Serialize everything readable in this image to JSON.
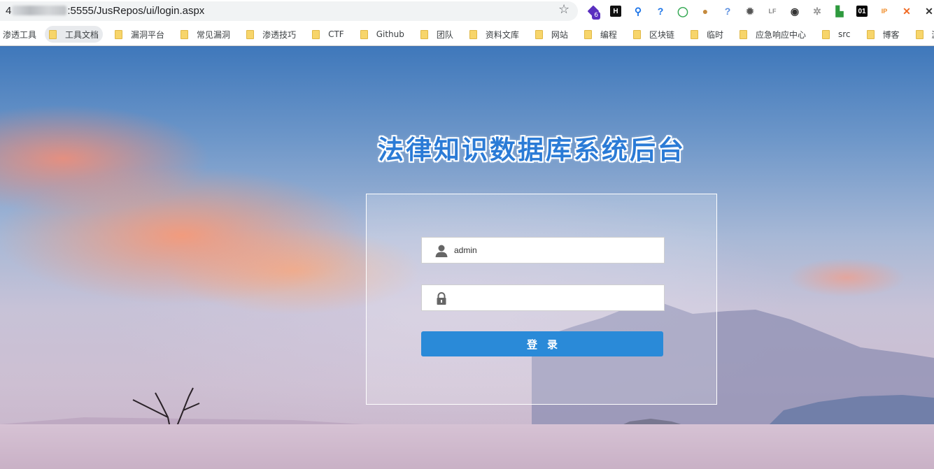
{
  "browser": {
    "url_prefix": "4",
    "url_visible": ":5555/JusRepos/ui/login.aspx",
    "bookmark_star_icon": "star-icon",
    "extensions": [
      {
        "name": "extension-diamond-icon",
        "label": "",
        "color": "#5a2fbf",
        "badge": "6"
      },
      {
        "name": "extension-h-icon",
        "label": "H",
        "color": "#111111"
      },
      {
        "name": "extension-pin-icon",
        "label": "⚲",
        "color": "#1a73e8"
      },
      {
        "name": "extension-question-icon",
        "label": "?",
        "color": "#1a73e8"
      },
      {
        "name": "extension-ring-icon",
        "label": "◯",
        "color": "#34a853"
      },
      {
        "name": "extension-cookie-icon",
        "label": "●",
        "color": "#c58a3d"
      },
      {
        "name": "extension-help-icon",
        "label": "?",
        "color": "#5b8fe0"
      },
      {
        "name": "extension-gear-icon",
        "label": "✹",
        "color": "#555555"
      },
      {
        "name": "extension-lf-icon",
        "label": "LF",
        "color": "#888888"
      },
      {
        "name": "extension-mask-icon",
        "label": "◉",
        "color": "#333333"
      },
      {
        "name": "extension-spoke-icon",
        "label": "✲",
        "color": "#999999"
      },
      {
        "name": "extension-leaf-icon",
        "label": "▙",
        "color": "#2e9a3e"
      },
      {
        "name": "extension-01-icon",
        "label": "01",
        "color": "#000000"
      },
      {
        "name": "extension-ip-icon",
        "label": "IP",
        "color": "#f08a24"
      },
      {
        "name": "extension-orange-icon",
        "label": "✕",
        "color": "#f06a24"
      },
      {
        "name": "extension-x-icon",
        "label": "✕",
        "color": "#333333"
      }
    ],
    "bookmarks": [
      {
        "label": "渗透工具",
        "folder": false
      },
      {
        "label": "工具文档",
        "folder": true
      },
      {
        "label": "漏洞平台",
        "folder": true
      },
      {
        "label": "常见漏洞",
        "folder": true
      },
      {
        "label": "渗透技巧",
        "folder": true
      },
      {
        "label": "CTF",
        "folder": true
      },
      {
        "label": "Github",
        "folder": true
      },
      {
        "label": "团队",
        "folder": true
      },
      {
        "label": "资料文库",
        "folder": true
      },
      {
        "label": "网站",
        "folder": true
      },
      {
        "label": "编程",
        "folder": true
      },
      {
        "label": "区块链",
        "folder": true
      },
      {
        "label": "临时",
        "folder": true
      },
      {
        "label": "应急响应中心",
        "folder": true
      },
      {
        "label": "src",
        "folder": true
      },
      {
        "label": "博客",
        "folder": true
      },
      {
        "label": "漏洞跟踪",
        "folder": true
      }
    ]
  },
  "page": {
    "title": "法律知识数据库系统后台",
    "username_value": "admin",
    "password_value": "",
    "login_label": "登录",
    "accent_color": "#2a8ad8",
    "user_icon": "user-icon",
    "lock_icon": "lock-icon"
  }
}
